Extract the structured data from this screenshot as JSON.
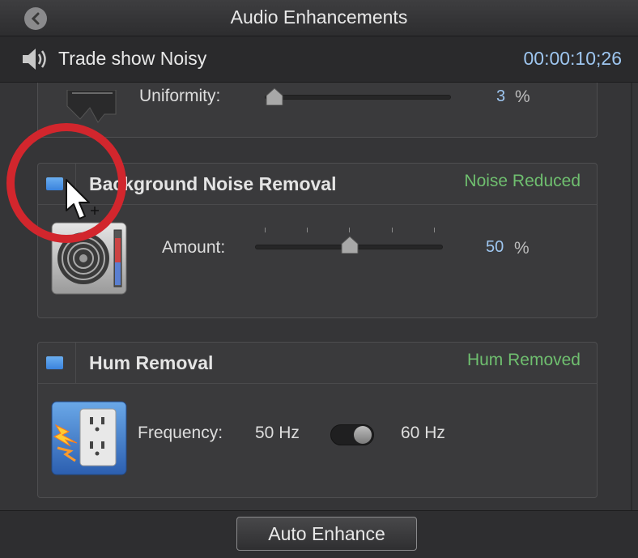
{
  "window": {
    "title": "Audio Enhancements"
  },
  "clip": {
    "name": "Trade show Noisy",
    "timecode": "00:00:10;26"
  },
  "equalization_partial": {
    "param_label": "Uniformity:",
    "value": "3",
    "unit": "%",
    "slider_fraction": 0.03
  },
  "noise_removal": {
    "title": "Background Noise Removal",
    "status": "Noise Reduced",
    "enabled": true,
    "param_label": "Amount:",
    "value": "50",
    "unit": "%",
    "slider_fraction": 0.5,
    "icon": "fan-speaker-icon"
  },
  "hum_removal": {
    "title": "Hum Removal",
    "status": "Hum Removed",
    "enabled": true,
    "param_label": "Frequency:",
    "option_a": "50 Hz",
    "option_b": "60 Hz",
    "selected": "60 Hz",
    "icon": "power-outlet-icon"
  },
  "footer": {
    "button_label": "Auto Enhance"
  },
  "colors": {
    "accent_blue": "#4a90e2",
    "status_green": "#6fbf6f",
    "highlight_red": "#d2262d"
  }
}
